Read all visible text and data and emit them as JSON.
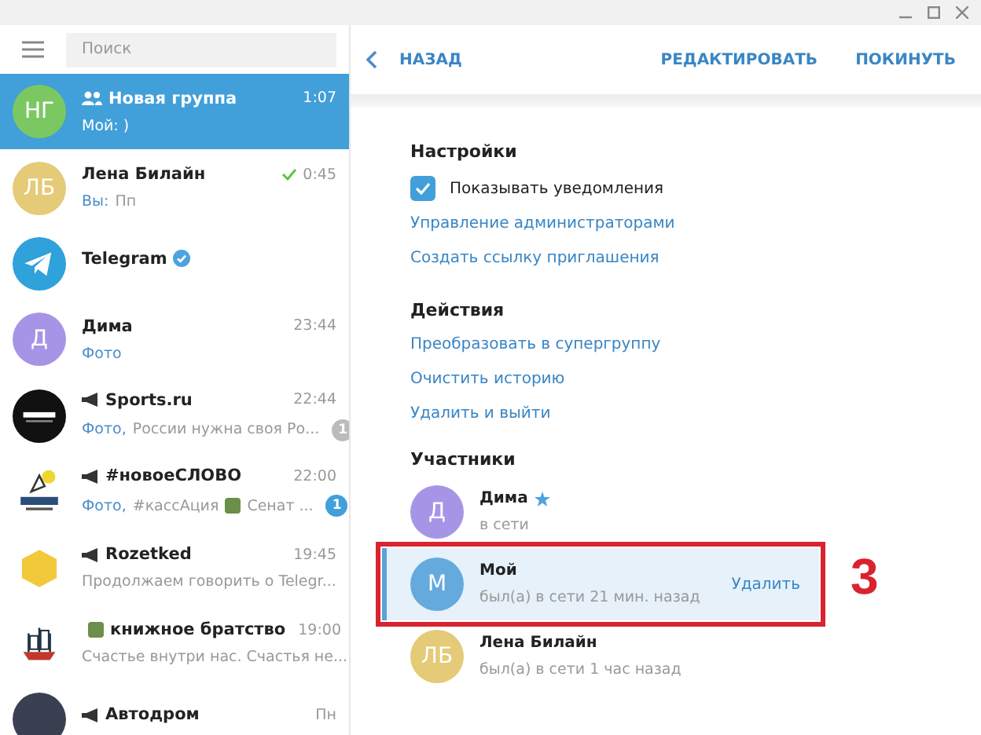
{
  "sidebar": {
    "search": {
      "placeholder": "Поиск"
    },
    "chats": [
      {
        "kind": "group",
        "name": "Новая группа",
        "time": "1:07",
        "avatar": {
          "kind": "initials",
          "text": "НГ",
          "color": "#7bc862"
        },
        "preview": [
          {
            "kind": "text",
            "text": "Мой: )"
          }
        ],
        "selected": true
      },
      {
        "kind": "user",
        "name": "Лена Билайн",
        "time": "0:45",
        "read": true,
        "avatar": {
          "kind": "initials",
          "text": "ЛБ",
          "color": "#e5ca77"
        },
        "prefix": "Вы:",
        "preview": [
          {
            "kind": "text",
            "text": "Пп"
          }
        ],
        "selected": false
      },
      {
        "kind": "user",
        "name": "Telegram",
        "verified": true,
        "avatar": {
          "kind": "telegram"
        },
        "selected": false
      },
      {
        "kind": "user",
        "name": "Дима",
        "time": "23:44",
        "avatar": {
          "kind": "initials",
          "text": "Д",
          "color": "#a695e7"
        },
        "prefix": "Фото",
        "selected": false
      },
      {
        "kind": "channel",
        "name": "Sports.ru",
        "time": "22:44",
        "avatar": {
          "kind": "logo-dark"
        },
        "prefix": "Фото,",
        "preview": [
          {
            "kind": "text",
            "text": "России нужна своя Ро..."
          }
        ],
        "badge": {
          "count": "1",
          "muted": true
        },
        "selected": false
      },
      {
        "kind": "channel",
        "name": "#новоеСЛОВО",
        "time": "22:00",
        "avatar": {
          "kind": "logo-drawing"
        },
        "prefix": "Фото,",
        "preview": [
          {
            "kind": "text",
            "text": "#кассАция"
          },
          {
            "kind": "sticker"
          },
          {
            "kind": "text",
            "text": "Сенат ..."
          }
        ],
        "badge": {
          "count": "1",
          "muted": false
        },
        "selected": false
      },
      {
        "kind": "channel",
        "name": "Rozetked",
        "time": "19:45",
        "avatar": {
          "kind": "hexagon"
        },
        "preview": [
          {
            "kind": "text",
            "text": "Продолжаем говорить о Telegr..."
          }
        ],
        "selected": false
      },
      {
        "kind": "channel",
        "name": "книжное братство",
        "name_sticker": true,
        "time": "19:00",
        "avatar": {
          "kind": "ship"
        },
        "preview": [
          {
            "kind": "text",
            "text": "Счастье внутри нас. Счастья не..."
          }
        ],
        "selected": false
      },
      {
        "kind": "channel",
        "name": "Автодром",
        "time": "Пн",
        "avatar": {
          "kind": "photo"
        },
        "selected": false
      }
    ]
  },
  "header": {
    "back": "НАЗАД",
    "actions": [
      "РЕДАКТИРОВАТЬ",
      "ПОКИНУТЬ"
    ]
  },
  "settings": {
    "title": "Настройки",
    "notifications": {
      "label": "Показывать уведомления",
      "checked": true
    },
    "links": [
      "Управление администраторами",
      "Создать ссылку приглашения"
    ]
  },
  "actions": {
    "title": "Действия",
    "links": [
      "Преобразовать в супергруппу",
      "Очистить историю",
      "Удалить и выйти"
    ]
  },
  "members": {
    "title": "Участники",
    "items": [
      {
        "name": "Дима",
        "status": "в сети",
        "admin": true,
        "avatar": {
          "text": "Д",
          "color": "#a695e7"
        },
        "selected": false
      },
      {
        "name": "Мой",
        "status": "был(а) в сети 21 мин. назад",
        "avatar": {
          "text": "М",
          "color": "#65aadd"
        },
        "selected": true,
        "remove": "Удалить",
        "annotation": "3"
      },
      {
        "name": "Лена Билайн",
        "status": "был(а) в сети 1 час назад",
        "avatar": {
          "text": "ЛБ",
          "color": "#e5ca77"
        },
        "selected": false
      }
    ]
  }
}
